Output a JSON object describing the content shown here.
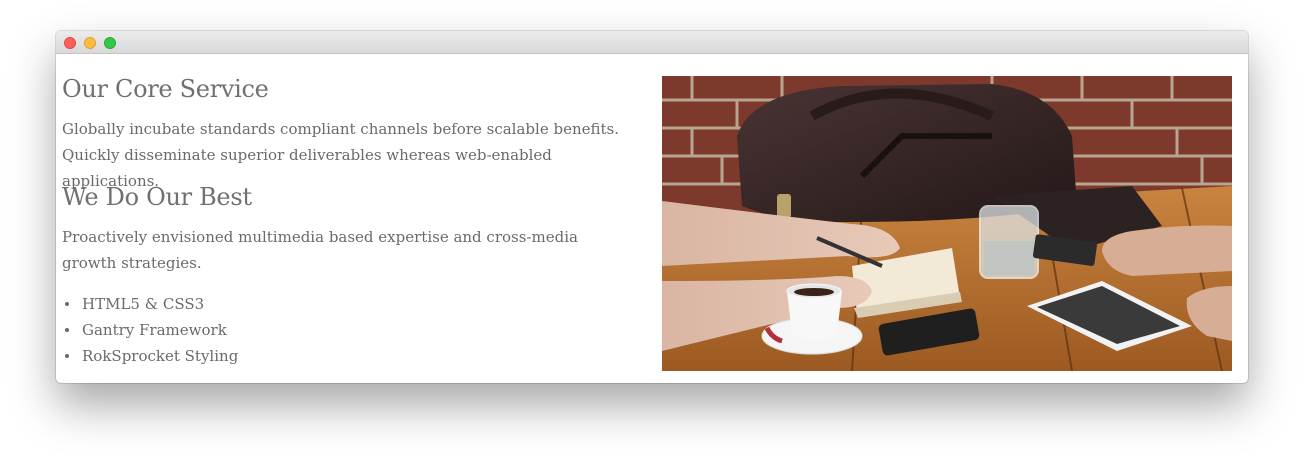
{
  "window": {
    "controls": [
      "close",
      "minimize",
      "maximize"
    ]
  },
  "main": {
    "core": {
      "title": "Our Core Service",
      "body": "Globally incubate standards compliant channels before scalable benefits. Quickly disseminate superior deliverables whereas web-enabled applications."
    },
    "best": {
      "title": "We Do Our Best",
      "body": "Proactively envisioned multimedia based expertise and cross-media growth strategies."
    },
    "features": [
      "HTML5 & CSS3",
      "Gantry Framework",
      "RokSprocket Styling"
    ]
  },
  "colors": {
    "text": "#6a6a6a",
    "heading": "#707070",
    "close": "#fc605c",
    "minimize": "#fdbc40",
    "maximize": "#34c84a"
  }
}
